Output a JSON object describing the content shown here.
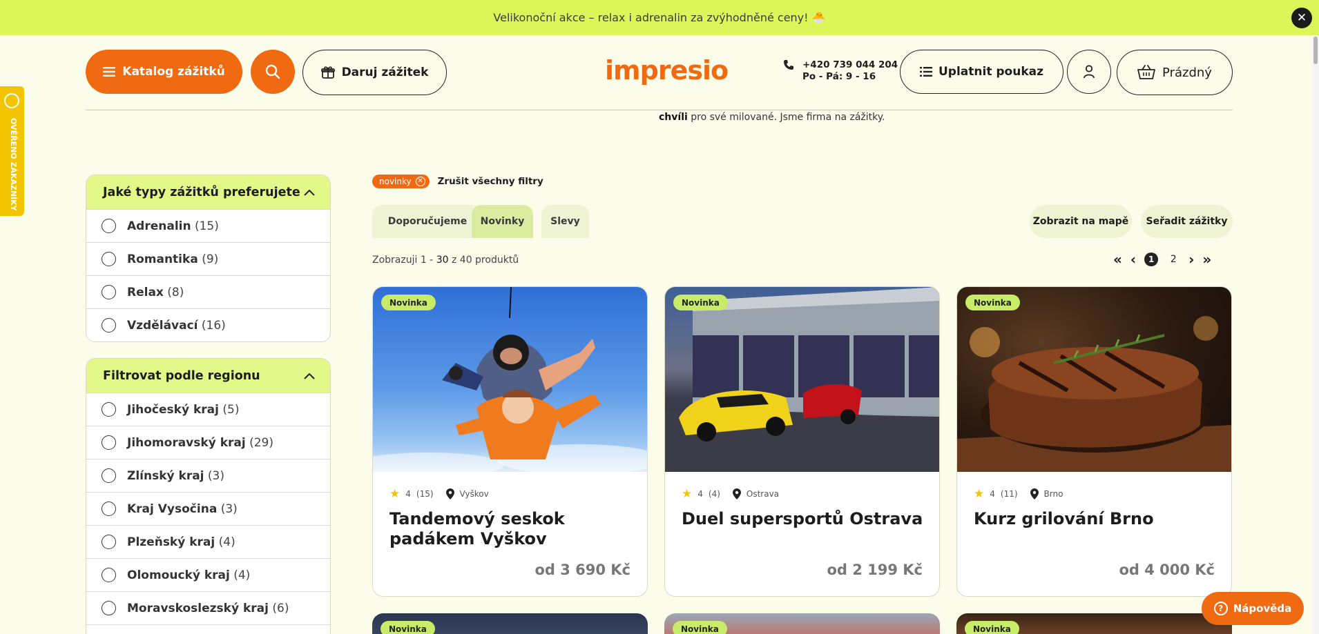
{
  "promo": {
    "text": "Velikonoční akce – relax i adrenalin za zvýhodněné ceny! 🐣",
    "close": "✕"
  },
  "header": {
    "catalog_label": "Katalog zážitků",
    "gift_label": "Daruj zážitek",
    "logo_text": "impresio",
    "phone_number": "+420 739 044 204",
    "phone_hours": "Po - Pá: 9 - 16",
    "voucher_label": "Uplatnit poukaz",
    "cart_label": "Prázdný"
  },
  "tagline": {
    "bold": "chvíli",
    "rest": " pro své milované. Jsme firma na zážitky."
  },
  "side_badge": "OVĚŘENO ZÁKAZNÍKY",
  "filters": {
    "types": {
      "title": "Jaké typy zážitků preferujete",
      "items": [
        {
          "name": "Adrenalin",
          "count": "(15)"
        },
        {
          "name": "Romantika",
          "count": "(9)"
        },
        {
          "name": "Relax",
          "count": "(8)"
        },
        {
          "name": "Vzdělávací",
          "count": "(16)"
        }
      ]
    },
    "region": {
      "title": "Filtrovat podle regionu",
      "items": [
        {
          "name": "Jihočeský kraj",
          "count": "(5)"
        },
        {
          "name": "Jihomoravský kraj",
          "count": "(29)"
        },
        {
          "name": "Zlínský kraj",
          "count": "(3)"
        },
        {
          "name": "Kraj Vysočina",
          "count": "(3)"
        },
        {
          "name": "Plzeňský kraj",
          "count": "(4)"
        },
        {
          "name": "Olomoucký kraj",
          "count": "(4)"
        },
        {
          "name": "Moravskoslezský kraj",
          "count": "(6)"
        }
      ]
    }
  },
  "active_filter": {
    "chip": "novinky",
    "clear_all": "Zrušit všechny filtry"
  },
  "tabs": [
    {
      "label": "Doporučujeme",
      "active": false
    },
    {
      "label": "Novinky",
      "active": true
    },
    {
      "label": "Slevy",
      "active": false
    }
  ],
  "map_button": "Zobrazit na mapě",
  "sort_button": "Seřadit zážitky",
  "results": {
    "prefix": "Zobrazuji 1 - ",
    "shown": "30",
    "suffix": " z 40 produktů"
  },
  "pagination": {
    "first": "«",
    "prev": "‹",
    "pages": [
      "1",
      "2"
    ],
    "current": "1",
    "next": "›",
    "last": "»"
  },
  "cards": [
    {
      "badge": "Novinka",
      "rating": "4",
      "reviews": "(15)",
      "location": "Vyškov",
      "title": "Tandemový seskok padákem Vyškov",
      "price": "od 3 690 Kč"
    },
    {
      "badge": "Novinka",
      "rating": "4",
      "reviews": "(4)",
      "location": "Ostrava",
      "title": "Duel supersportů Ostrava",
      "price": "od 2 199 Kč"
    },
    {
      "badge": "Novinka",
      "rating": "4",
      "reviews": "(11)",
      "location": "Brno",
      "title": "Kurz grilování Brno",
      "price": "od 4 000 Kč"
    }
  ],
  "next_row_badges": [
    "Novinka",
    "Novinka",
    "Novinka"
  ],
  "help_label": "Nápověda",
  "colors": {
    "accent": "#f06a12",
    "promo_bg": "#dcf65a",
    "filter_head": "#e4f88a",
    "badge": "#c8ec6a",
    "page_bg": "#fbfdea"
  }
}
